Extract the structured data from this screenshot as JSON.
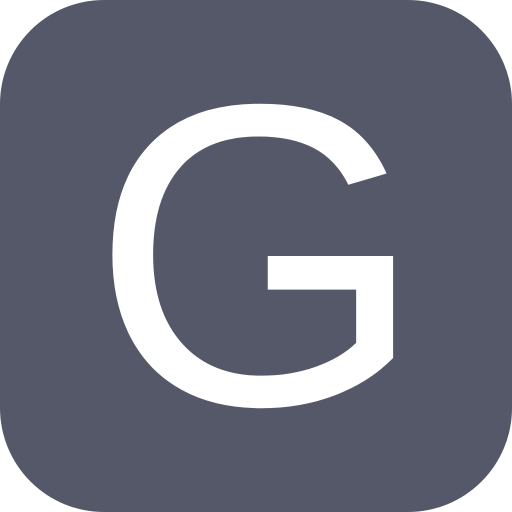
{
  "icon": {
    "letter": "G",
    "background_color": "#555869",
    "letter_color": "#ffffff"
  }
}
